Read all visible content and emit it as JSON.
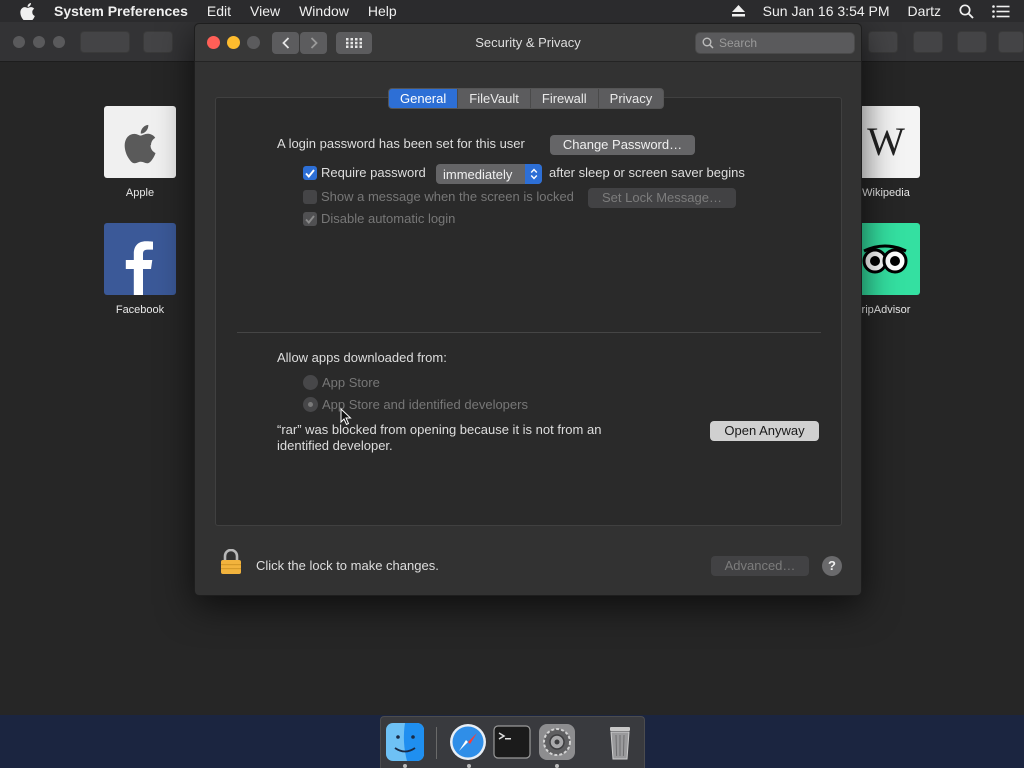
{
  "menubar": {
    "app_name": "System Preferences",
    "items": [
      "Edit",
      "View",
      "Window",
      "Help"
    ],
    "datetime": "Sun Jan 16  3:54 PM",
    "user": "Dartz"
  },
  "favorites": [
    {
      "label": "Apple"
    },
    {
      "label": "Facebook"
    },
    {
      "label": "Wikipedia"
    },
    {
      "label": "ripAdvisor"
    }
  ],
  "dialog": {
    "title": "Security & Privacy",
    "search_placeholder": "Search",
    "tabs": [
      {
        "label": "General",
        "active": true
      },
      {
        "label": "FileVault",
        "active": false
      },
      {
        "label": "Firewall",
        "active": false
      },
      {
        "label": "Privacy",
        "active": false
      }
    ],
    "login": {
      "message": "A login password has been set for this user",
      "change_password_label": "Change Password…",
      "require_password_label": "Require password",
      "require_password_checked": true,
      "require_password_value": "immediately",
      "require_password_suffix": "after sleep or screen saver begins",
      "show_message_label": "Show a message when the screen is locked",
      "show_message_checked": false,
      "set_lock_message_label": "Set Lock Message…",
      "disable_auto_login_label": "Disable automatic login",
      "disable_auto_login_checked": true
    },
    "downloads": {
      "heading": "Allow apps downloaded from:",
      "options": [
        {
          "label": "App Store",
          "selected": false
        },
        {
          "label": "App Store and identified developers",
          "selected": true
        }
      ],
      "blocked_line1": "“rar” was blocked from opening because it is not from an",
      "blocked_line2": "identified developer.",
      "open_anyway_label": "Open Anyway"
    },
    "footer": {
      "lock_text": "Click the lock to make changes.",
      "advanced_label": "Advanced…",
      "help_label": "?"
    }
  },
  "dock": {
    "apps": [
      "finder-icon",
      "safari-icon",
      "terminal-icon",
      "system-preferences-icon",
      "trash-icon"
    ]
  },
  "colors": {
    "accent": "#2d6fd6",
    "close": "#ff5f57",
    "minimize": "#febc2e",
    "maximize": "#5b5b5d"
  }
}
